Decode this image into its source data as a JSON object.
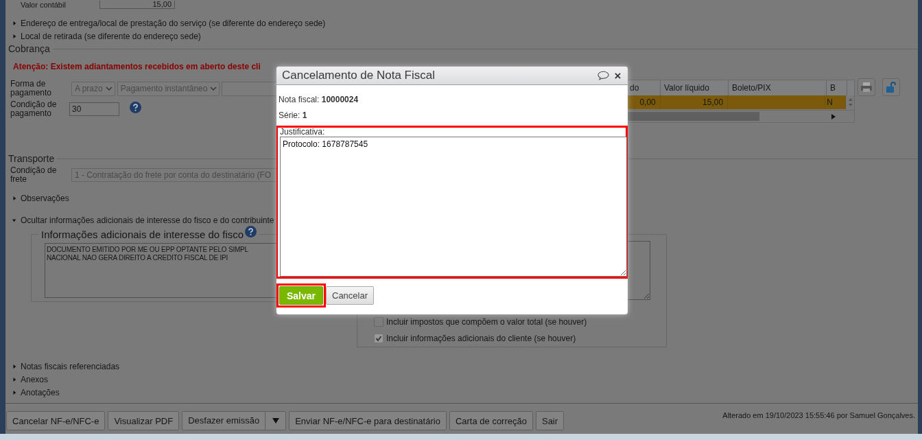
{
  "top_row": {
    "label": "Valor contábil",
    "value": "15,00"
  },
  "sections_top": [
    {
      "label": "Endereço de entrega/local de prestação do serviço (se diferente do endereço sede)",
      "expanded": false
    },
    {
      "label": "Local de retirada (se diferente do endereço sede)",
      "expanded": false
    }
  ],
  "cobranca": {
    "title": "Cobrança",
    "warning": "Atenção: Existem adiantamentos recebidos em aberto deste cli",
    "payment_form_label": "Forma de pagamento",
    "payment_selects": [
      "A prazo",
      "Pagamento instantâneo"
    ],
    "condition_label": "Condição de pagamento",
    "condition_value": "30",
    "table": {
      "columns": [
        "do",
        "Valor líquido",
        "Boleto/PIX",
        "B"
      ],
      "rows": [
        {
          "cells": [
            "0,00",
            "15,00",
            null,
            "N"
          ],
          "selected": true
        }
      ]
    }
  },
  "transporte": {
    "title": "Transporte",
    "freight_label": "Condição de frete",
    "freight_value": "1 - Contratação do frete por conta do destinatário (FO"
  },
  "sections_mid": [
    {
      "label": "Observações",
      "expanded": false
    },
    {
      "label": "Ocultar informações adicionais de interesse do fisco e do contribuinte",
      "expanded": true
    }
  ],
  "fisco": {
    "legend": "Informações adicionais de interesse do fisco",
    "value": "DOCUMENTO EMITIDO POR ME OU EPP OPTANTE PELO SIMPL\nNACIONAL NAO GERA DIREITO A CREDITO FISCAL DE IPI"
  },
  "contribuinte": {
    "checkboxes": [
      {
        "label": "Incluir impostos que compõem o valor total (se houver)",
        "checked": false
      },
      {
        "label": "Incluir informações adicionais do cliente (se houver)",
        "checked": true
      }
    ]
  },
  "sections_bottom": [
    {
      "label": "Notas fiscais referenciadas",
      "expanded": false
    },
    {
      "label": "Anexos",
      "expanded": false
    },
    {
      "label": "Anotações",
      "expanded": false
    }
  ],
  "footer": {
    "buttons": [
      {
        "label": "Cancelar NF-e/NFC-e",
        "kind": "plain"
      },
      {
        "label": "Visualizar PDF",
        "kind": "plain"
      },
      {
        "label": "Desfazer emissão",
        "kind": "split"
      },
      {
        "label": "Enviar NF-e/NFC-e para destinatário",
        "kind": "plain"
      },
      {
        "label": "Carta de correção",
        "kind": "plain"
      },
      {
        "label": "Sair",
        "kind": "plain"
      }
    ],
    "status": "Alterado em 19/10/2023 15:55:46 por Samuel Gonçalves."
  },
  "dialog": {
    "title": "Cancelamento de Nota Fiscal",
    "invoice_label": "Nota fiscal:",
    "invoice_number": "10000024",
    "series_label": "Série:",
    "series_value": "1",
    "justification": {
      "label": "Justificativa:",
      "value": "Protocolo: 1678787545",
      "highlighted": true
    },
    "buttons": [
      {
        "label": "Salvar",
        "kind": "primary",
        "highlighted": true
      },
      {
        "label": "Cancelar",
        "kind": "secondary",
        "highlighted": false
      }
    ]
  }
}
